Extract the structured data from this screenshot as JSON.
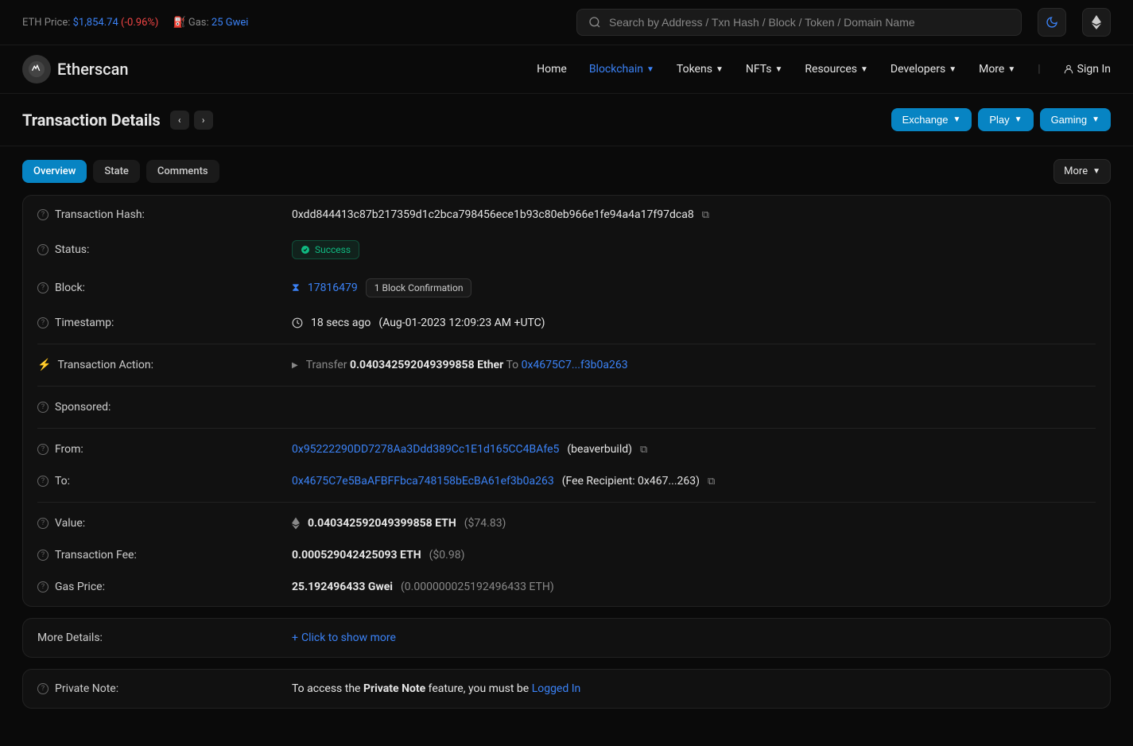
{
  "topbar": {
    "eth_price_label": "ETH Price:",
    "eth_price": "$1,854.74",
    "eth_change": "(-0.96%)",
    "gas_label": "Gas:",
    "gas_value": "25 Gwei",
    "search_placeholder": "Search by Address / Txn Hash / Block / Token / Domain Name"
  },
  "brand": "Etherscan",
  "nav": {
    "home": "Home",
    "blockchain": "Blockchain",
    "tokens": "Tokens",
    "nfts": "NFTs",
    "resources": "Resources",
    "developers": "Developers",
    "more": "More",
    "signin": "Sign In"
  },
  "page": {
    "title": "Transaction Details"
  },
  "actions": {
    "exchange": "Exchange",
    "play": "Play",
    "gaming": "Gaming"
  },
  "tabs": {
    "overview": "Overview",
    "state": "State",
    "comments": "Comments",
    "more": "More"
  },
  "labels": {
    "txhash": "Transaction Hash:",
    "status": "Status:",
    "block": "Block:",
    "timestamp": "Timestamp:",
    "txaction": "Transaction Action:",
    "sponsored": "Sponsored:",
    "from": "From:",
    "to": "To:",
    "value": "Value:",
    "txfee": "Transaction Fee:",
    "gasprice": "Gas Price:",
    "moredetails": "More Details:",
    "privatenote": "Private Note:"
  },
  "tx": {
    "hash": "0xdd844413c87b217359d1c2bca798456ece1b93c80eb966e1fe94a4a17f97dca8",
    "status": "Success",
    "block": "17816479",
    "confirmations": "1 Block Confirmation",
    "timestamp_ago": "18 secs ago",
    "timestamp_full": "(Aug-01-2023 12:09:23 AM +UTC)",
    "action_transfer": "Transfer",
    "action_amount": "0.040342592049399858 Ether",
    "action_to": "To",
    "action_to_addr": "0x4675C7...f3b0a263",
    "from_addr": "0x95222290DD7278Aa3Ddd389Cc1E1d165CC4BAfe5",
    "from_label": "(beaverbuild)",
    "to_addr": "0x4675C7e5BaAFBFFbca748158bEcBA61ef3b0a263",
    "to_label": "(Fee Recipient: 0x467...263)",
    "value_eth": "0.040342592049399858 ETH",
    "value_usd": "($74.83)",
    "fee_eth": "0.000529042425093 ETH",
    "fee_usd": "($0.98)",
    "gas_gwei": "25.192496433 Gwei",
    "gas_eth": "(0.000000025192496433 ETH)",
    "show_more": "Click to show more",
    "private_note_pre": "To access the",
    "private_note_bold": "Private Note",
    "private_note_mid": "feature, you must be",
    "logged_in": "Logged In"
  }
}
